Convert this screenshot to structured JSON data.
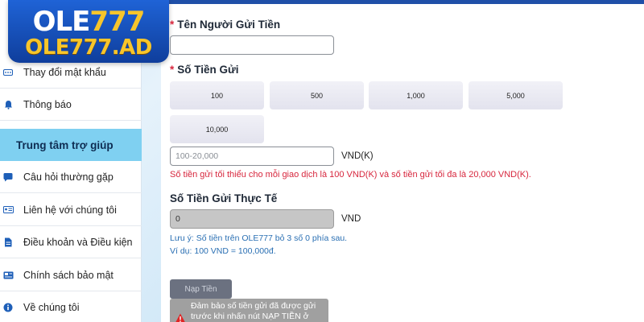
{
  "logo": {
    "main_text": "OLE",
    "main_number": "777",
    "sub_text": "OLE777.AD"
  },
  "sidebar": {
    "items": [
      {
        "label": "Thay đổi mật khẩu",
        "icon": "password-icon"
      },
      {
        "label": "Thông báo",
        "icon": "bell-icon"
      },
      {
        "label": "Trung tâm trợ giúp",
        "icon": ""
      },
      {
        "label": "Câu hỏi thường gặp",
        "icon": "faq-icon"
      },
      {
        "label": "Liên hệ với chúng tôi",
        "icon": "contact-card-icon"
      },
      {
        "label": "Điều khoản và Điều kiện",
        "icon": "document-icon"
      },
      {
        "label": "Chính sách bảo mật",
        "icon": "policy-icon"
      },
      {
        "label": "Về chúng tôi",
        "icon": "info-icon"
      }
    ]
  },
  "form": {
    "sender_label": "Tên Người Gửi Tiền",
    "sender_value": "",
    "amount_label": "Số Tiền Gửi",
    "required_mark": "*",
    "amount_options": [
      "100",
      "500",
      "1,000",
      "5,000",
      "10,000"
    ],
    "amount_placeholder": "100-20,000",
    "amount_unit": "VND(K)",
    "limit_warning": "Số tiền gửi tối thiểu cho mỗi giao dịch là 100 VND(K) và số tiền gửi tối đa là 20,000 VND(K).",
    "actual_label": "Số Tiền Gửi Thực Tế",
    "actual_value": "0",
    "actual_unit": "VND",
    "note_line1": "Lưu ý: Số tiền trên OLE777 bỏ 3 số 0 phía sau.",
    "note_line2": "Ví dụ: 100 VND = 100,000đ.",
    "submit_label": "Nạp Tiền",
    "tooltip_line1": "Đảm bảo số tiền gửi đã được gửi",
    "tooltip_line2": "trước khi nhấn nút NẠP TIỀN ở"
  },
  "colors": {
    "accent_blue": "#1f4fa8",
    "help_highlight": "#7fd0f1",
    "error_red": "#d7263d",
    "note_blue": "#2a6fb3",
    "logo_yellow": "#f7c52b"
  }
}
